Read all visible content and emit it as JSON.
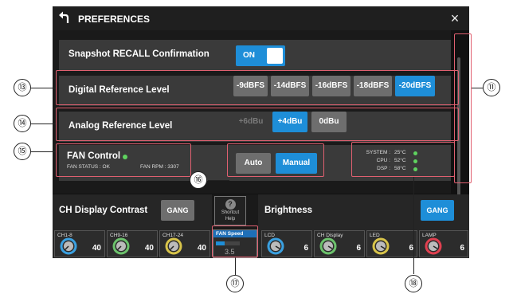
{
  "header": {
    "title": "PREFERENCES"
  },
  "snapshot_recall": {
    "label": "Snapshot RECALL Confirmation",
    "toggle_label": "ON"
  },
  "digital_ref": {
    "label": "Digital Reference Level",
    "options": [
      "-9dBFS",
      "-14dBFS",
      "-16dBFS",
      "-18dBFS",
      "-20dBFS"
    ],
    "selected": "-20dBFS"
  },
  "analog_ref": {
    "label": "Analog Reference Level",
    "options": [
      "+6dBu",
      "+4dBu",
      "0dBu"
    ],
    "selected": "+4dBu"
  },
  "fan": {
    "label": "FAN Control",
    "status": "FAN STATUS : OK",
    "rpm": "FAN RPM : 3307",
    "modes": [
      "Auto",
      "Manual"
    ],
    "selected": "Manual"
  },
  "temps": [
    {
      "name": "SYSTEM :",
      "value": "25°C"
    },
    {
      "name": "CPU :",
      "value": "52°C"
    },
    {
      "name": "DSP :",
      "value": "58°C"
    }
  ],
  "contrast": {
    "label": "CH Display Contrast",
    "gang_label": "GANG",
    "knobs": [
      {
        "name": "CH1-8",
        "value": "40",
        "color": "#3aa0e0"
      },
      {
        "name": "CH9-16",
        "value": "40",
        "color": "#6cc26c"
      },
      {
        "name": "CH17-24",
        "value": "40",
        "color": "#d8c44a"
      }
    ]
  },
  "help": {
    "line1": "Shortcut",
    "line2": "Help"
  },
  "fan_speed": {
    "label": "FAN Speed",
    "value": "3.5",
    "level": 0.35
  },
  "brightness": {
    "label": "Brightness",
    "gang_label": "GANG",
    "knobs": [
      {
        "name": "LCD",
        "value": "6",
        "color": "#3aa0e0"
      },
      {
        "name": "CH Display",
        "value": "6",
        "color": "#6cc26c"
      },
      {
        "name": "LED",
        "value": "6",
        "color": "#d8c44a"
      },
      {
        "name": "LAMP",
        "value": "6",
        "color": "#e04050"
      }
    ]
  },
  "callouts": [
    "⑪",
    "⑬",
    "⑭",
    "⑮",
    "⑯",
    "⑰",
    "⑱"
  ],
  "colors": {
    "accent": "#1e8ed8",
    "highlight": "#e06070",
    "led": "#5fd35f"
  }
}
